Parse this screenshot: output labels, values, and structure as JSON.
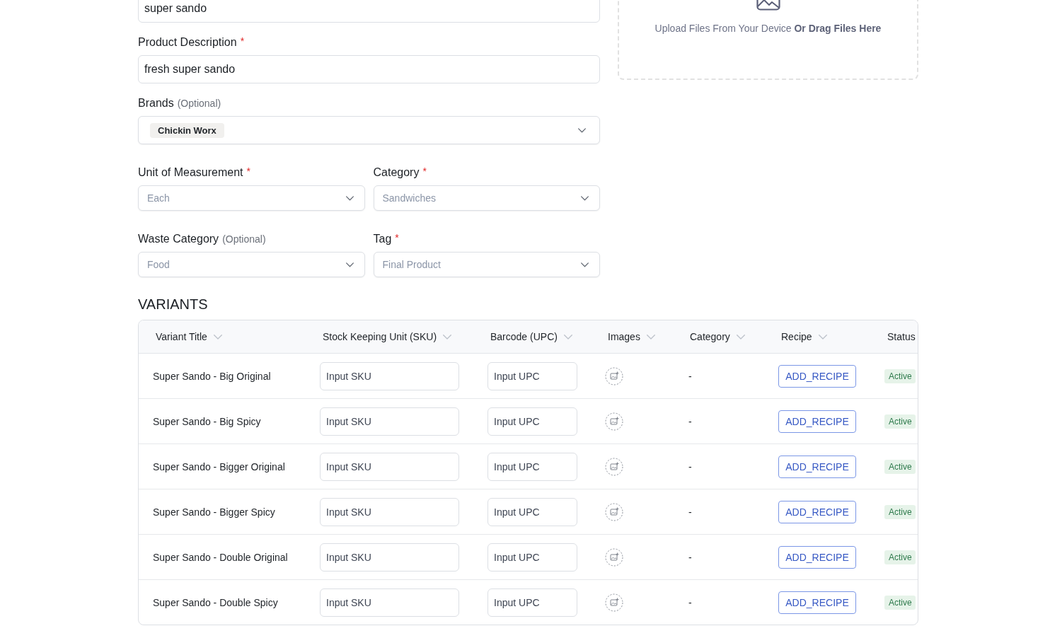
{
  "form": {
    "rows": [
      [
        {
          "kind": "text",
          "value": "super sando"
        }
      ],
      [
        {
          "kind": "text",
          "label": "Product Description",
          "required_mark": "*",
          "value": "fresh super sando"
        }
      ],
      [
        {
          "kind": "tags",
          "label": "Brands",
          "note": "(Optional)",
          "tags": [
            "Chickin Worx"
          ]
        }
      ],
      [
        {
          "kind": "select",
          "label": "Unit of Measurement",
          "required_mark": "*",
          "value": "Each",
          "disabled": true
        },
        {
          "kind": "select",
          "label": "Category",
          "required_mark": "*",
          "value": "Sandwiches",
          "disabled": true
        }
      ],
      [
        {
          "kind": "select",
          "label": "Waste Category",
          "note": "(Optional)",
          "value": "Food",
          "disabled": true
        },
        {
          "kind": "select",
          "label": "Tag",
          "required_mark": "*",
          "value": "Final Product",
          "disabled": true
        }
      ]
    ]
  },
  "upload_area": {
    "text": "Upload Files From Your Device **Or Drag Files Here**"
  },
  "variants": {
    "heading": "VARIANTS",
    "columns": [
      {
        "label": "Variant Title",
        "sort_icon": true
      },
      {
        "label": "Stock Keeping Unit (SKU)",
        "sort_icon": true
      },
      {
        "label": "Barcode (UPC)",
        "sort_icon": true
      },
      {
        "label": "Images",
        "sort_icon": true
      },
      {
        "label": "Category",
        "sort_icon": true
      },
      {
        "label": "Recipe",
        "sort_icon": true
      },
      {
        "label": "Status",
        "sort_icon": false
      }
    ],
    "rows": [
      {
        "title": "Super Sando - Big Original",
        "sku_placeholder": "Input SKU",
        "upc_placeholder": "Input UPC",
        "category": "-",
        "recipe_button": "ADD_RECIPE",
        "status": "Active"
      },
      {
        "title": "Super Sando - Big Spicy",
        "sku_placeholder": "Input SKU",
        "upc_placeholder": "Input UPC",
        "category": "-",
        "recipe_button": "ADD_RECIPE",
        "status": "Active"
      },
      {
        "title": "Super Sando - Bigger Original",
        "sku_placeholder": "Input SKU",
        "upc_placeholder": "Input UPC",
        "category": "-",
        "recipe_button": "ADD_RECIPE",
        "status": "Active"
      },
      {
        "title": "Super Sando - Bigger Spicy",
        "sku_placeholder": "Input SKU",
        "upc_placeholder": "Input UPC",
        "category": "-",
        "recipe_button": "ADD_RECIPE",
        "status": "Active"
      },
      {
        "title": "Super Sando - Double Original",
        "sku_placeholder": "Input SKU",
        "upc_placeholder": "Input UPC",
        "category": "-",
        "recipe_button": "ADD_RECIPE",
        "status": "Active"
      },
      {
        "title": "Super Sando - Double Spicy",
        "sku_placeholder": "Input SKU",
        "upc_placeholder": "Input UPC",
        "category": "-",
        "recipe_button": "ADD_RECIPE",
        "status": "Active"
      }
    ]
  }
}
